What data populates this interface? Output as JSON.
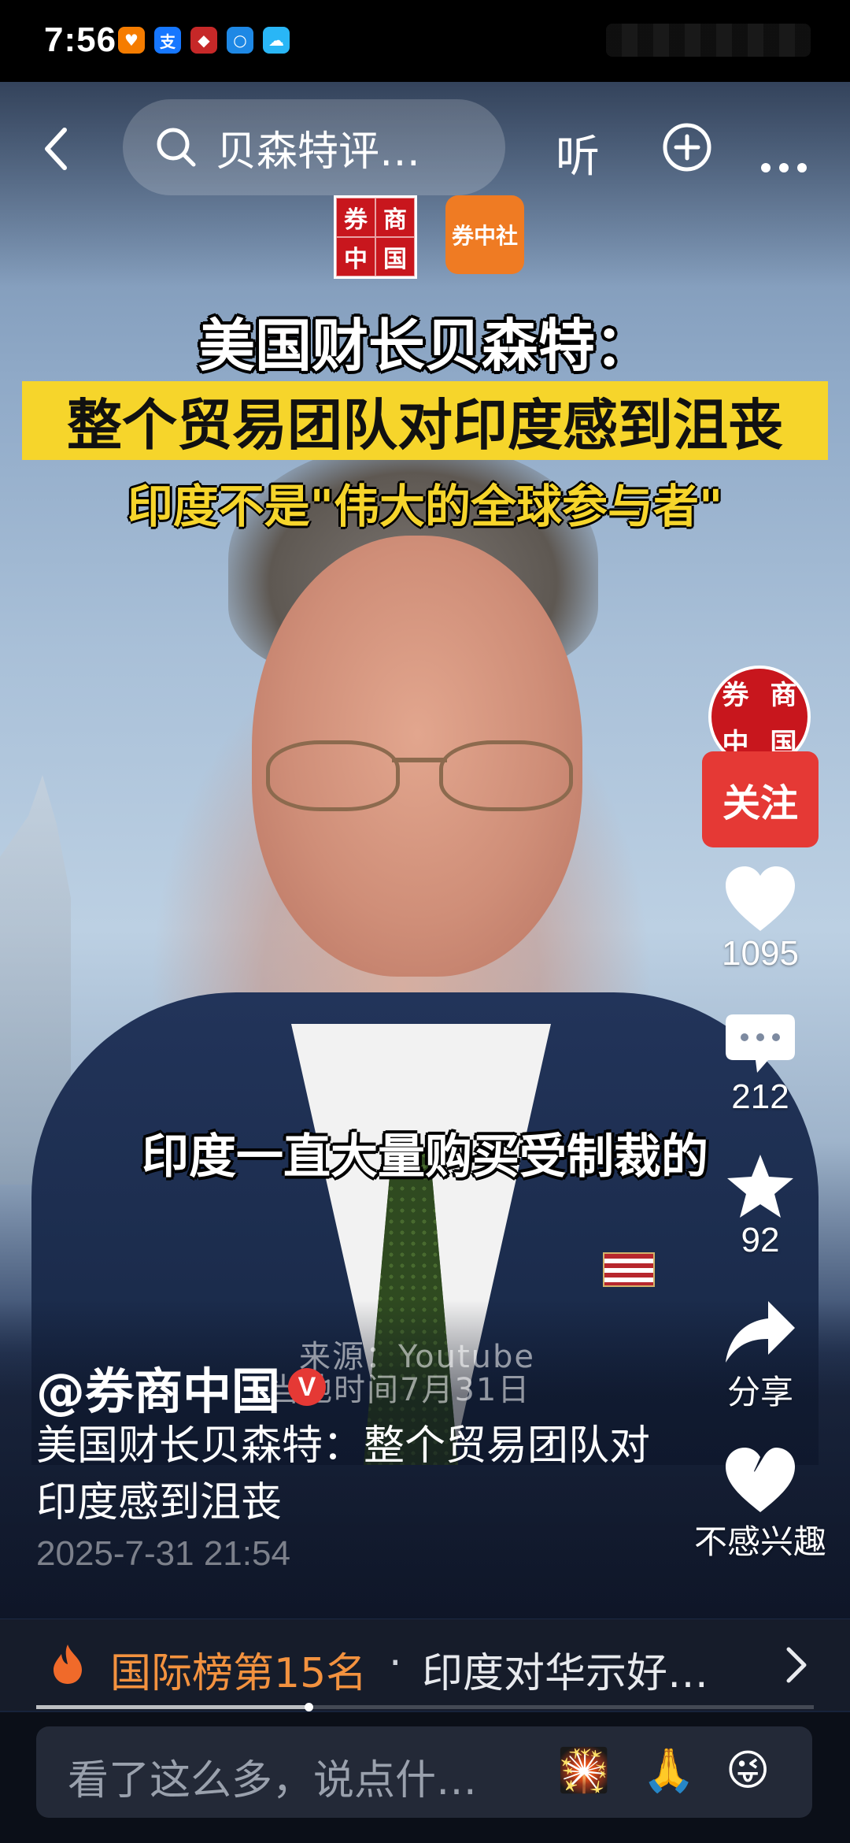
{
  "status_bar": {
    "time": "7:56"
  },
  "nav": {
    "search_text": "贝森特评…",
    "listen_label": "听"
  },
  "video": {
    "logo_seal_chars": [
      "券",
      "商",
      "中",
      "国"
    ],
    "logo_badge_text": "券中社",
    "headline_1": "美国财长贝森特：",
    "headline_2": "整个贸易团队对印度感到沮丧",
    "headline_3": "印度不是\"伟大的全球参与者\"",
    "subtitle": "印度一直大量购买受制裁的",
    "source": "来源：Youtube",
    "local_time": "当地时间7月31日"
  },
  "actions": {
    "follow_label": "关注",
    "likes": "1095",
    "comments": "212",
    "favorites": "92",
    "share_label": "分享",
    "dislike_label": "不感兴趣"
  },
  "post": {
    "author": "@券商中国",
    "verified_mark": "V",
    "description": "美国财长贝森特：整个贸易团队对印度感到沮丧",
    "date": "2025-7-31 21:54"
  },
  "rank": {
    "label": "国际榜第15名",
    "separator": "·",
    "title": "印度对华示好…"
  },
  "progress": {
    "played_fraction": 0.35
  },
  "comment_bar": {
    "placeholder": "看了这么多，说点什…",
    "emojis": [
      "🎇",
      "🙏",
      "😜"
    ]
  },
  "colors": {
    "accent_red": "#e53935",
    "headline_yellow": "#f6d52b",
    "rank_orange": "#f3923f"
  }
}
